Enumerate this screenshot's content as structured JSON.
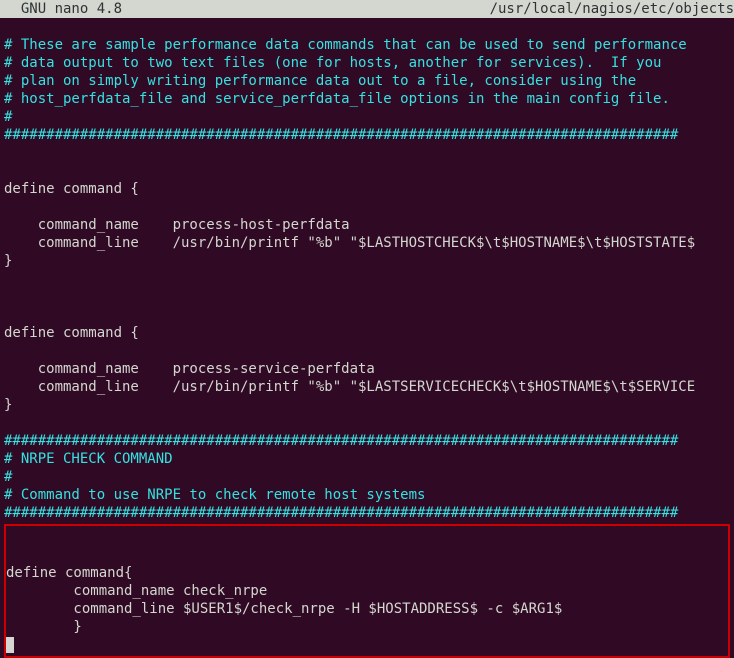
{
  "titlebar": {
    "left": "  GNU nano 4.8",
    "right": "/usr/local/nagios/etc/objects"
  },
  "lines": {
    "c1": "# These are sample performance data commands that can be used to send performance",
    "c2": "# data output to two text files (one for hosts, another for services).  If you",
    "c3": "# plan on simply writing performance data out to a file, consider using the",
    "c4": "# host_perfdata_file and service_perfdata_file options in the main config file.",
    "c5": "#",
    "hr1": "################################################################################",
    "blank": "",
    "def1_open": "define command {",
    "def1_name": "    command_name    process-host-perfdata",
    "def1_line": "    command_line    /usr/bin/printf \"%b\" \"$LASTHOSTCHECK$\\t$HOSTNAME$\\t$HOSTSTATE$",
    "def_close": "}",
    "def2_open": "define command {",
    "def2_name": "    command_name    process-service-perfdata",
    "def2_line": "    command_line    /usr/bin/printf \"%b\" \"$LASTSERVICECHECK$\\t$HOSTNAME$\\t$SERVICE",
    "hr2": "################################################################################",
    "c6": "# NRPE CHECK COMMAND",
    "c7": "#",
    "c8": "# Command to use NRPE to check remote host systems",
    "hr3": "################################################################################"
  },
  "boxed": {
    "l1": "define command{",
    "l2": "        command_name check_nrpe",
    "l3": "        command_line $USER1$/check_nrpe -H $HOSTADDRESS$ -c $ARG1$",
    "l4": "        }"
  }
}
